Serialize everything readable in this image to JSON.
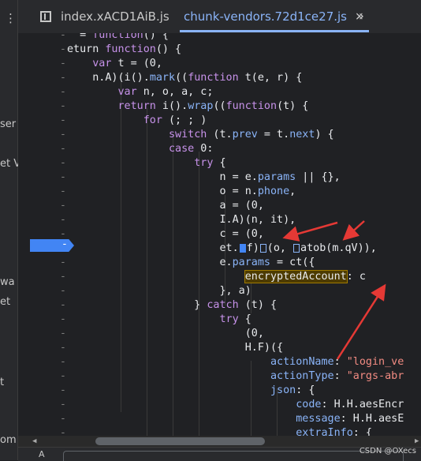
{
  "left_strip": {
    "fragments": [
      "ser",
      "et V",
      "wa",
      "et",
      "t",
      "om"
    ]
  },
  "tabs": [
    {
      "label": "index.xACD1AiB.js",
      "active": false
    },
    {
      "label": "chunk-vendors.72d1ce27.js",
      "active": true
    }
  ],
  "tab_close": "×",
  "more_tabs": "»",
  "gutter_dash": "-",
  "code_lines": [
    "  = function() {",
    "eturn function() {",
    "    var t = (0,",
    "    n.A)(i().mark((function t(e, r) {",
    "        var n, o, a, c;",
    "        return i().wrap((function(t) {",
    "            for (; ; )",
    "                switch (t.prev = t.next) {",
    "                case 0:",
    "                    try {",
    "                        n = e.params || {},",
    "                        o = n.phone,",
    "                        a = (0,",
    "                        I.A)(n, it),",
    "                        c = (0,",
    "                        et.",
    "                        e.params = ct({",
    "                            encryptedAccount: c",
    "                        }, a)",
    "                    } catch (t) {",
    "                        try {",
    "                            (0,",
    "                            H.F)({",
    "                                actionName: \"login_ve",
    "                                actionType: \"args-abr",
    "                                json: {",
    "                                    code: H.H.aesEncr",
    "                                    message: H.H.aesE",
    "                                    extraInfo: {"
  ],
  "breakpoint_line": {
    "prefix": "et.",
    "part1": "f)",
    "part2": "(o, ",
    "part3": "atob(m.qV)),"
  },
  "highlighted_token": "encryptedAccount",
  "bottom": {
    "aa": "A"
  },
  "watermark": "CSDN @OXecs"
}
